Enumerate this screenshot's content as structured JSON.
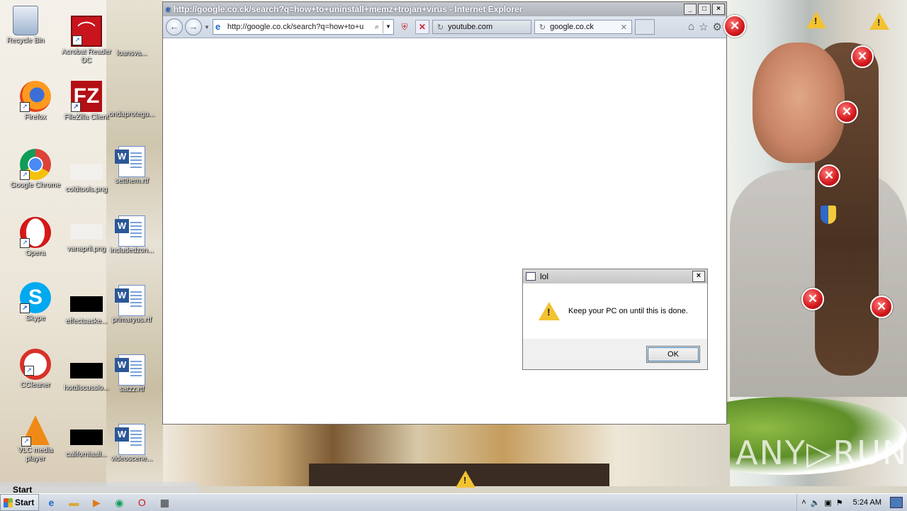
{
  "desktop_icons": [
    {
      "label": "Recycle Bin",
      "icon": "recycle-bin-icon"
    },
    {
      "label": "Acrobat Reader DC",
      "icon": "acrobat-icon"
    },
    {
      "label": "loansva...",
      "icon": "file-icon"
    },
    {
      "label": "Firefox",
      "icon": "firefox-icon"
    },
    {
      "label": "FileZilla Client",
      "icon": "filezilla-icon"
    },
    {
      "label": "ondaprotegu...",
      "icon": "file-icon"
    },
    {
      "label": "Google Chrome",
      "icon": "chrome-icon"
    },
    {
      "label": "coldtools.png",
      "icon": "image-icon"
    },
    {
      "label": "setthem.rtf",
      "icon": "word-doc-icon"
    },
    {
      "label": "Opera",
      "icon": "opera-icon"
    },
    {
      "label": "vanapril.png",
      "icon": "image-icon"
    },
    {
      "label": "includedzon...",
      "icon": "word-doc-icon"
    },
    {
      "label": "Skype",
      "icon": "skype-icon"
    },
    {
      "label": "effectsaske...",
      "icon": "image-icon"
    },
    {
      "label": "primaryus.rtf",
      "icon": "word-doc-icon"
    },
    {
      "label": "CCleaner",
      "icon": "ccleaner-icon"
    },
    {
      "label": "hotdiscussio...",
      "icon": "image-icon"
    },
    {
      "label": "satzz.rtf",
      "icon": "word-doc-icon"
    },
    {
      "label": "VLC media player",
      "icon": "vlc-icon"
    },
    {
      "label": "californiaall...",
      "icon": "image-icon"
    },
    {
      "label": "videoscene...",
      "icon": "word-doc-icon"
    }
  ],
  "ie_window": {
    "title": "http://google.co.ck/search?q=how+to+uninstall+memz+trojan+virus - Internet Explorer",
    "address": "http://google.co.ck/search?q=how+to+u",
    "tabs": [
      {
        "label": "youtube.com"
      },
      {
        "label": "google.co.ck"
      }
    ],
    "minimize": "_",
    "maximize": "□",
    "close": "×"
  },
  "dialog": {
    "title": "lol",
    "message": "Keep your PC on until this is done.",
    "ok_label": "OK",
    "close": "×"
  },
  "taskbar": {
    "start_label": "Start",
    "ghost_start_label": "Start",
    "clock": "5:24 AM"
  },
  "watermark": "ANY▷RUN",
  "colors": {
    "error_red": "#d2171b",
    "warning_yellow": "#f2c230",
    "ie_blue": "#1d67c8"
  }
}
